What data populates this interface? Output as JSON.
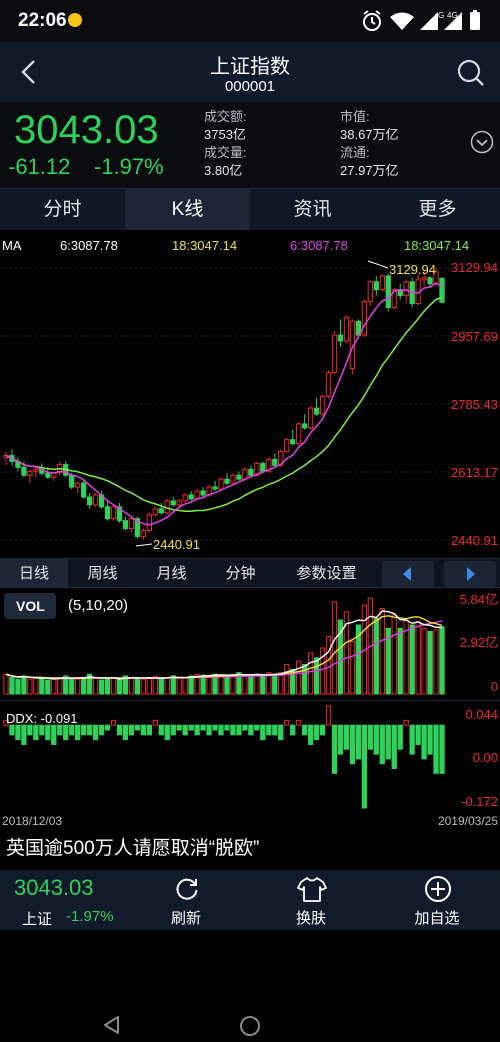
{
  "status_bar": {
    "time": "22:06",
    "network": "G",
    "network2": "4G"
  },
  "header": {
    "title": "上证指数",
    "code": "000001"
  },
  "quote": {
    "price": "3043.03",
    "change": "-61.12",
    "change_pct": "-1.97%",
    "turnover_label": "成交额:",
    "turnover": "3753亿",
    "volume_label": "成交量:",
    "volume": "3.80亿",
    "mktcap_label": "市值:",
    "mktcap": "38.67万亿",
    "float_label": "流通:",
    "float": "27.97万亿"
  },
  "tabs": [
    {
      "label": "分时",
      "active": false
    },
    {
      "label": "K线",
      "active": true
    },
    {
      "label": "资讯",
      "active": false
    },
    {
      "label": "更多",
      "active": false
    }
  ],
  "kline": {
    "ma_label": "MA",
    "ma6_text": "6:3087.78",
    "ma18_text": "18:3047.14",
    "ma6_text_right": "6:3087.78",
    "ma18_text_right": "18:3047.14",
    "y_ticks": [
      "3129.94",
      "2957.69",
      "2785.43",
      "2613.17",
      "2440.91"
    ],
    "high_label": "3129.94",
    "low_label": "2440.91"
  },
  "periods": [
    {
      "label": "日线",
      "active": true
    },
    {
      "label": "周线",
      "active": false
    },
    {
      "label": "月线",
      "active": false
    },
    {
      "label": "分钟",
      "active": false
    },
    {
      "label": "参数设置",
      "active": false
    }
  ],
  "volume": {
    "label": "VOL",
    "params": "(5,10,20)",
    "y_top": "5.84亿",
    "y_mid": "2.92亿",
    "y_bottom": "0"
  },
  "ddx": {
    "label": "DDX: -0.091",
    "y_top": "0.044",
    "y_mid": "0.00",
    "y_bottom": "-0.172"
  },
  "dates": {
    "start": "2018/12/03",
    "end": "2019/03/25"
  },
  "news": {
    "headline": "英国逾500万人请愿取消“脱欧”"
  },
  "bottom_bar": {
    "price": "3043.03",
    "name": "上证",
    "pct": "-1.97%",
    "refresh": "刷新",
    "skin": "换肤",
    "add": "加自选"
  },
  "colors": {
    "up": "#f0262c",
    "down": "#2ed15a",
    "ma6": "#e040e8",
    "ma18": "#7df040",
    "vol_ma5": "#ffffff",
    "vol_ma10": "#f0e040",
    "vol_ma20": "#e040e8"
  },
  "chart_data": [
    {
      "type": "candlestick",
      "title": "上证指数 日K",
      "x_range": [
        "2018/12/03",
        "2019/03/25"
      ],
      "ylim": [
        2440.91,
        3129.94
      ],
      "ohlc": [
        [
          2650,
          2665,
          2630,
          2655
        ],
        [
          2655,
          2670,
          2630,
          2640
        ],
        [
          2640,
          2650,
          2615,
          2625
        ],
        [
          2625,
          2640,
          2600,
          2605
        ],
        [
          2605,
          2620,
          2585,
          2615
        ],
        [
          2615,
          2630,
          2600,
          2620
        ],
        [
          2620,
          2635,
          2605,
          2610
        ],
        [
          2610,
          2625,
          2595,
          2600
        ],
        [
          2600,
          2615,
          2590,
          2612
        ],
        [
          2612,
          2640,
          2605,
          2632
        ],
        [
          2632,
          2640,
          2600,
          2605
        ],
        [
          2605,
          2610,
          2570,
          2575
        ],
        [
          2575,
          2590,
          2560,
          2585
        ],
        [
          2585,
          2595,
          2545,
          2550
        ],
        [
          2550,
          2560,
          2520,
          2530
        ],
        [
          2530,
          2560,
          2525,
          2555
        ],
        [
          2555,
          2565,
          2520,
          2525
        ],
        [
          2525,
          2540,
          2490,
          2495
        ],
        [
          2495,
          2530,
          2490,
          2525
        ],
        [
          2525,
          2535,
          2485,
          2490
        ],
        [
          2490,
          2500,
          2465,
          2470
        ],
        [
          2470,
          2500,
          2460,
          2495
        ],
        [
          2495,
          2500,
          2445,
          2450
        ],
        [
          2450,
          2470,
          2441,
          2465
        ],
        [
          2465,
          2510,
          2460,
          2505
        ],
        [
          2505,
          2525,
          2500,
          2520
        ],
        [
          2520,
          2535,
          2505,
          2510
        ],
        [
          2510,
          2545,
          2505,
          2540
        ],
        [
          2540,
          2550,
          2525,
          2530
        ],
        [
          2530,
          2545,
          2520,
          2540
        ],
        [
          2540,
          2560,
          2535,
          2555
        ],
        [
          2555,
          2565,
          2540,
          2545
        ],
        [
          2545,
          2570,
          2540,
          2565
        ],
        [
          2565,
          2575,
          2550,
          2555
        ],
        [
          2555,
          2580,
          2550,
          2575
        ],
        [
          2575,
          2590,
          2565,
          2570
        ],
        [
          2570,
          2600,
          2565,
          2595
        ],
        [
          2595,
          2610,
          2580,
          2585
        ],
        [
          2585,
          2610,
          2580,
          2605
        ],
        [
          2605,
          2615,
          2590,
          2595
        ],
        [
          2595,
          2625,
          2590,
          2620
        ],
        [
          2620,
          2630,
          2600,
          2605
        ],
        [
          2605,
          2640,
          2600,
          2635
        ],
        [
          2635,
          2640,
          2610,
          2615
        ],
        [
          2615,
          2650,
          2610,
          2645
        ],
        [
          2645,
          2660,
          2625,
          2630
        ],
        [
          2630,
          2670,
          2625,
          2665
        ],
        [
          2665,
          2700,
          2660,
          2695
        ],
        [
          2695,
          2720,
          2680,
          2685
        ],
        [
          2685,
          2740,
          2680,
          2735
        ],
        [
          2735,
          2760,
          2720,
          2725
        ],
        [
          2725,
          2780,
          2720,
          2775
        ],
        [
          2775,
          2800,
          2755,
          2760
        ],
        [
          2760,
          2810,
          2755,
          2805
        ],
        [
          2805,
          2870,
          2800,
          2865
        ],
        [
          2865,
          2970,
          2860,
          2960
        ],
        [
          2960,
          3000,
          2930,
          2945
        ],
        [
          2945,
          3010,
          2940,
          3005
        ],
        [
          2875,
          3000,
          2860,
          2995
        ],
        [
          2995,
          3000,
          2950,
          2960
        ],
        [
          2960,
          3050,
          2955,
          3045
        ],
        [
          3045,
          3100,
          3035,
          3095
        ],
        [
          3095,
          3110,
          3060,
          3075
        ],
        [
          3075,
          3115,
          3070,
          3110
        ],
        [
          3110,
          3115,
          3020,
          3030
        ],
        [
          3030,
          3080,
          3025,
          3075
        ],
        [
          3075,
          3090,
          3050,
          3060
        ],
        [
          3060,
          3100,
          3040,
          3095
        ],
        [
          3095,
          3105,
          3030,
          3040
        ],
        [
          3040,
          3115,
          3035,
          3100
        ],
        [
          3100,
          3125,
          3085,
          3105
        ],
        [
          3105,
          3110,
          3080,
          3090
        ],
        [
          3090,
          3129.94,
          3085,
          3120
        ],
        [
          3104,
          3106,
          3040,
          3043
        ]
      ],
      "ma6_last": 3087.78,
      "ma18_last": 3047.14
    },
    {
      "type": "bar",
      "title": "VOL",
      "ylim": [
        0,
        5.84
      ],
      "values": [
        1.2,
        1.0,
        0.9,
        1.1,
        0.9,
        1.0,
        0.95,
        0.85,
        0.9,
        1.0,
        1.1,
        0.95,
        0.9,
        1.0,
        1.2,
        0.95,
        0.85,
        0.9,
        1.0,
        0.9,
        1.1,
        1.0,
        0.95,
        0.9,
        1.0,
        1.05,
        0.95,
        1.0,
        1.1,
        0.95,
        1.0,
        1.1,
        1.2,
        1.15,
        1.1,
        1.2,
        1.15,
        1.1,
        1.2,
        1.3,
        1.1,
        1.15,
        1.2,
        1.1,
        1.3,
        1.2,
        1.3,
        1.8,
        1.5,
        2.0,
        1.8,
        2.5,
        2.2,
        2.8,
        3.5,
        5.6,
        4.5,
        5.0,
        3.2,
        4.2,
        5.4,
        5.84,
        4.6,
        5.2,
        4.0,
        4.8,
        4.0,
        4.5,
        4.2,
        4.4,
        4.0,
        3.8,
        3.9,
        4.1
      ]
    },
    {
      "type": "bar",
      "title": "DDX",
      "ylim": [
        -0.172,
        0.044
      ],
      "values": [
        0.01,
        -0.02,
        -0.03,
        -0.04,
        -0.02,
        -0.03,
        -0.02,
        -0.03,
        -0.04,
        -0.02,
        -0.03,
        -0.02,
        -0.03,
        -0.02,
        -0.02,
        -0.03,
        -0.02,
        -0.01,
        0.01,
        -0.02,
        -0.03,
        -0.02,
        -0.01,
        -0.02,
        -0.02,
        0.01,
        -0.02,
        -0.03,
        -0.02,
        -0.01,
        -0.02,
        -0.01,
        -0.02,
        -0.01,
        -0.02,
        -0.01,
        -0.02,
        -0.01,
        -0.02,
        -0.02,
        -0.01,
        -0.02,
        -0.01,
        -0.03,
        -0.02,
        -0.02,
        -0.03,
        0.01,
        -0.02,
        0.01,
        -0.02,
        -0.04,
        -0.03,
        -0.02,
        0.04,
        -0.1,
        -0.06,
        -0.05,
        -0.08,
        -0.07,
        -0.172,
        -0.05,
        -0.06,
        -0.08,
        -0.07,
        -0.09,
        -0.05,
        0.01,
        -0.06,
        -0.04,
        -0.07,
        -0.06,
        -0.1,
        -0.1
      ]
    }
  ]
}
